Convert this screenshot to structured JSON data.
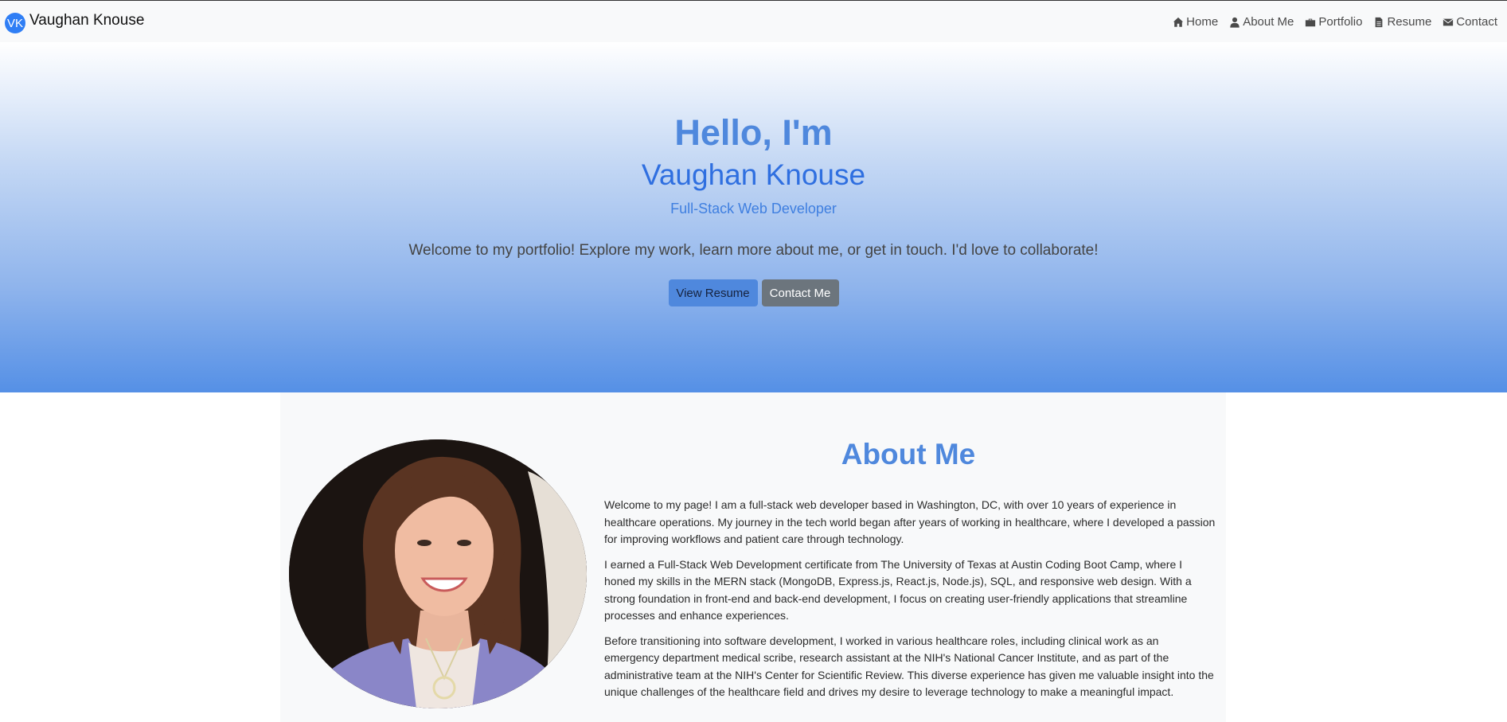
{
  "navbar": {
    "brand_logo": "VK",
    "brand_name": "Vaughan Knouse",
    "items": [
      {
        "label": "Home",
        "icon": "home-icon"
      },
      {
        "label": "About Me",
        "icon": "user-icon"
      },
      {
        "label": "Portfolio",
        "icon": "briefcase-icon"
      },
      {
        "label": "Resume",
        "icon": "file-icon"
      },
      {
        "label": "Contact",
        "icon": "envelope-icon"
      }
    ]
  },
  "hero": {
    "greeting": "Hello, I'm",
    "name": "Vaughan Knouse",
    "role": "Full-Stack Web Developer",
    "welcome": "Welcome to my portfolio! Explore my work, learn more about me, or get in touch. I'd love to collaborate!",
    "primary_button": "View Resume",
    "secondary_button": "Contact Me"
  },
  "about": {
    "title": "About Me",
    "paragraphs": [
      "Welcome to my page! I am a full-stack web developer based in Washington, DC, with over 10 years of experience in healthcare operations. My journey in the tech world began after years of working in healthcare, where I developed a passion for improving workflows and patient care through technology.",
      "I earned a Full-Stack Web Development certificate from The University of Texas at Austin Coding Boot Camp, where I honed my skills in the MERN stack (MongoDB, Express.js, React.js, Node.js), SQL, and responsive web design. With a strong foundation in front-end and back-end development, I focus on creating user-friendly applications that streamline processes and enhance experiences.",
      "Before transitioning into software development, I worked in various healthcare roles, including clinical work as an emergency department medical scribe, research assistant at the NIH's National Cancer Institute, and as part of the administrative team at the NIH's Center for Scientific Review. This diverse experience has given me valuable insight into the unique challenges of the healthcare field and drives my desire to leverage technology to make a meaningful impact."
    ]
  },
  "colors": {
    "accent": "#4f88dd",
    "name_blue": "#2f6fe0",
    "secondary_button": "#6c757d",
    "navbar_bg": "#f8f9fa"
  }
}
